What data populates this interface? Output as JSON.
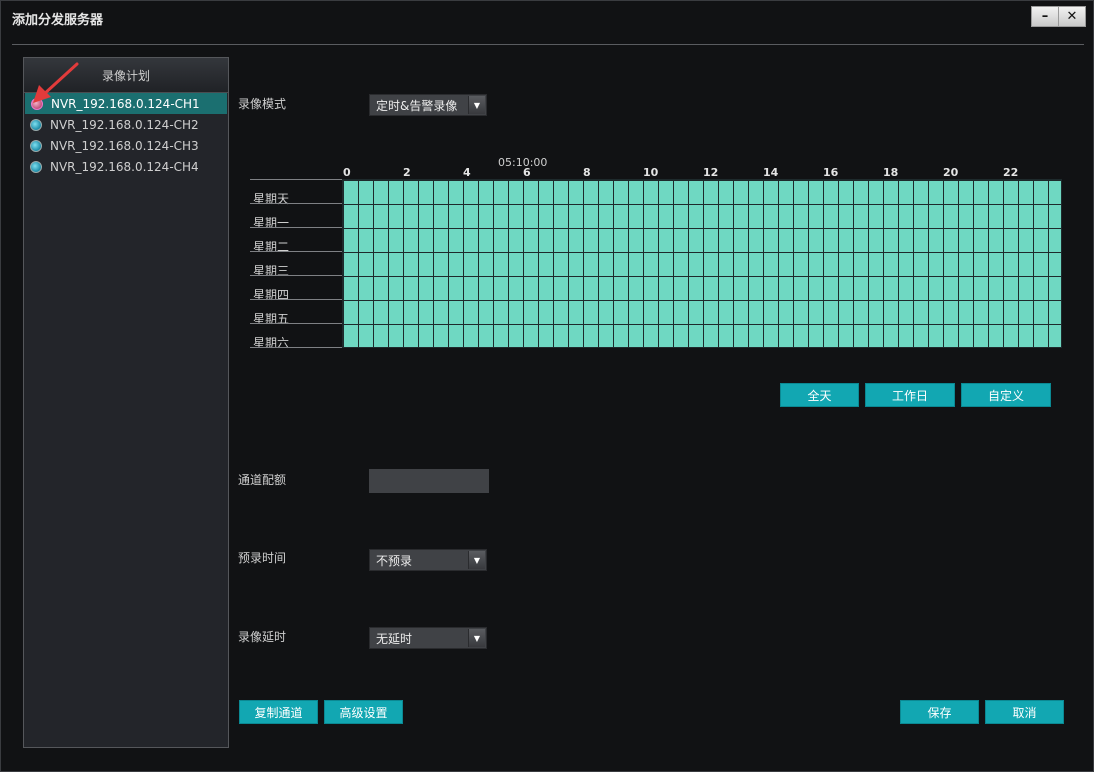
{
  "window": {
    "title": "添加分发服务器",
    "minimize_glyph": "–",
    "close_glyph": "✕"
  },
  "left_panel": {
    "header": "录像计划",
    "channels": [
      {
        "label": "NVR_192.168.0.124-CH1",
        "status": "pink-dot",
        "selected": true
      },
      {
        "label": "NVR_192.168.0.124-CH2",
        "status": "blue-dot",
        "selected": false
      },
      {
        "label": "NVR_192.168.0.124-CH3",
        "status": "blue-dot",
        "selected": false
      },
      {
        "label": "NVR_192.168.0.124-CH4",
        "status": "blue-dot",
        "selected": false
      }
    ]
  },
  "record_mode": {
    "label": "录像模式",
    "value": "定时&告警录像"
  },
  "schedule": {
    "time_marker": "05:10:00",
    "hour_labels": [
      "0",
      "2",
      "4",
      "6",
      "8",
      "10",
      "12",
      "14",
      "16",
      "18",
      "20",
      "22"
    ],
    "days": [
      "星期天",
      "星期一",
      "星期二",
      "星期三",
      "星期四",
      "星期五",
      "星期六"
    ],
    "cell_color": "#6fd8c2",
    "buttons": {
      "all_day": "全天",
      "workday": "工作日",
      "custom": "自定义"
    }
  },
  "channel_quota": {
    "label": "通道配额",
    "value": ""
  },
  "prerecord": {
    "label": "预录时间",
    "value": "不预录"
  },
  "record_delay": {
    "label": "录像延时",
    "value": "无延时"
  },
  "footer": {
    "copy_channel": "复制通道",
    "advanced": "高级设置",
    "save": "保存",
    "cancel": "取消"
  },
  "colors": {
    "accent": "#12a7b2",
    "selected_row": "#1b6f70",
    "arrow": "#e23b3b"
  }
}
